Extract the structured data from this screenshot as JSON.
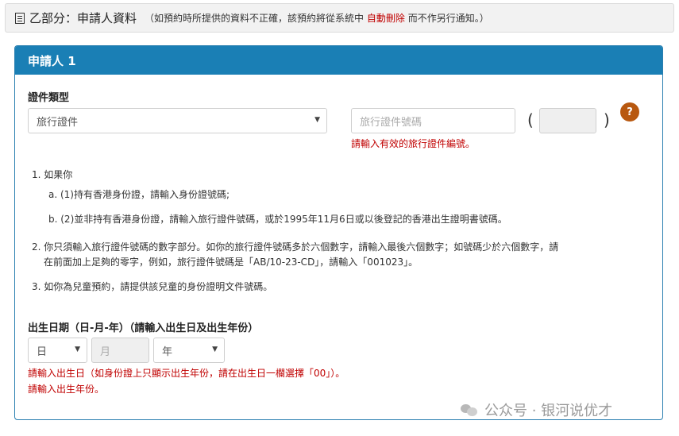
{
  "section": {
    "title": "乙部分：申請人資料",
    "note_prefix": "（如預約時所提供的資料不正確，該預約將從系統中",
    "note_red": "自動刪除",
    "note_suffix": "而不作另行通知。）"
  },
  "panel": {
    "title": "申請人 1"
  },
  "doc_type": {
    "label": "證件類型",
    "selected": "旅行證件",
    "number_placeholder": "旅行證件號碼",
    "error": "請輸入有效的旅行證件編號。",
    "help_icon": "?"
  },
  "instructions": {
    "i1": "1. 如果你",
    "i1a": "a. (1)持有香港身份證，請輸入身份證號碼;",
    "i1b": "b. (2)並非持有香港身份證，請輸入旅行證件號碼，或於1995年11月6日或以後登記的香港出生證明書號碼。",
    "i2_line1": "2. 你只須輸入旅行證件號碼的數字部分。如你的旅行證件號碼多於六個數字，請輸入最後六個數字；如號碼少於六個數字，請",
    "i2_line2": "在前面加上足夠的零字，例如，旅行證件號碼是「AB/10-23-CD」，請輸入「001023」。",
    "i3": "3. 如你為兒童預約，請提供該兒童的身份證明文件號碼。"
  },
  "dob": {
    "label": "出生日期（日-月-年）（請輸入出生日及出生年份）",
    "day": "日",
    "month": "月",
    "year": "年",
    "error1": "請輸入出生日（如身份證上只顯示出生年份，請在出生日一欄選擇「00」）。",
    "error2": "請輸入出生年份。"
  },
  "watermark": {
    "text": "公众号 · 银河说优才"
  }
}
